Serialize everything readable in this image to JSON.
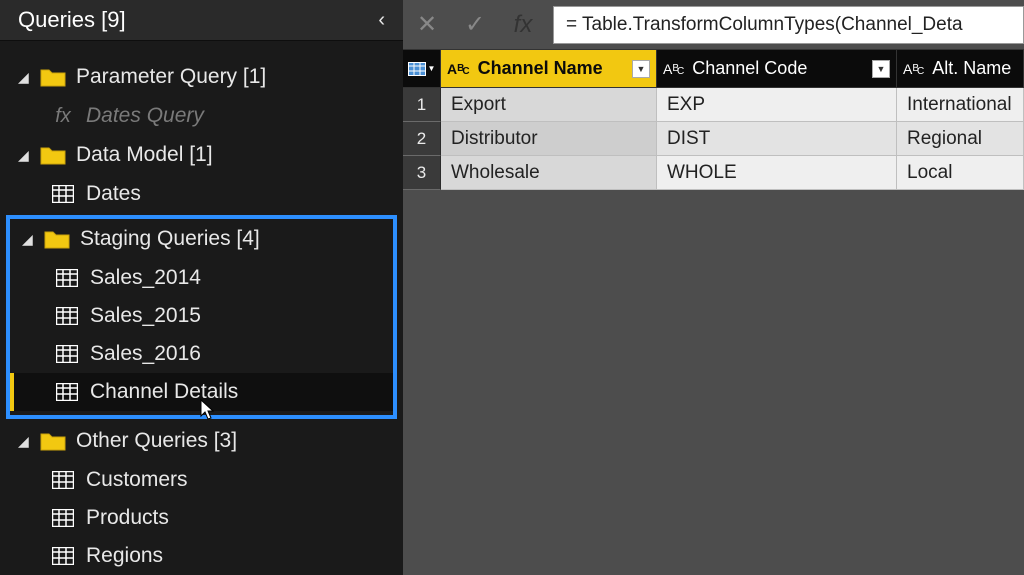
{
  "sidebar": {
    "title": "Queries [9]",
    "groups": [
      {
        "label": "Parameter Query [1]",
        "items": [
          {
            "label": "Dates Query",
            "type": "fx",
            "faded": true
          }
        ]
      },
      {
        "label": "Data Model [1]",
        "items": [
          {
            "label": "Dates",
            "type": "table"
          }
        ]
      }
    ],
    "highlighted_group": {
      "label": "Staging Queries [4]",
      "items": [
        {
          "label": "Sales_2014",
          "type": "table"
        },
        {
          "label": "Sales_2015",
          "type": "table"
        },
        {
          "label": "Sales_2016",
          "type": "table"
        },
        {
          "label": "Channel Details",
          "type": "table",
          "selected": true
        }
      ]
    },
    "groups_after": [
      {
        "label": "Other Queries [3]",
        "items": [
          {
            "label": "Customers",
            "type": "table"
          },
          {
            "label": "Products",
            "type": "table"
          },
          {
            "label": "Regions",
            "type": "table"
          }
        ]
      }
    ]
  },
  "formula_bar": {
    "cancel_glyph": "✕",
    "accept_glyph": "✓",
    "fx_label": "fx",
    "text": "= Table.TransformColumnTypes(Channel_Deta"
  },
  "table": {
    "columns": [
      {
        "name": "Channel Name",
        "selected": true
      },
      {
        "name": "Channel Code",
        "selected": false
      },
      {
        "name": "Alt. Name",
        "selected": false
      }
    ],
    "rows": [
      {
        "n": "1",
        "c0": "Export",
        "c1": "EXP",
        "c2": "International"
      },
      {
        "n": "2",
        "c0": "Distributor",
        "c1": "DIST",
        "c2": "Regional"
      },
      {
        "n": "3",
        "c0": "Wholesale",
        "c1": "WHOLE",
        "c2": "Local"
      }
    ]
  }
}
